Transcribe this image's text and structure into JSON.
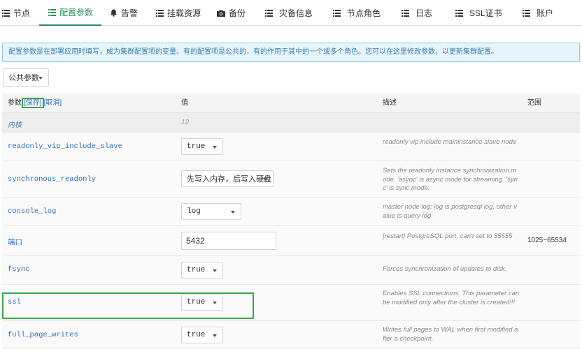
{
  "nav": {
    "items": [
      {
        "label": "节点",
        "icon": "list-icon"
      },
      {
        "label": "配置参数",
        "icon": "list-icon"
      },
      {
        "label": "告警",
        "icon": "bell-icon"
      },
      {
        "label": "挂载资源",
        "icon": "list-icon"
      },
      {
        "label": "备份",
        "icon": "camera-icon"
      },
      {
        "label": "灾备信息",
        "icon": "list-icon"
      },
      {
        "label": "节点角色",
        "icon": "list-icon"
      },
      {
        "label": "日志",
        "icon": "list-icon"
      },
      {
        "label": "SSL证书",
        "icon": "list-icon"
      },
      {
        "label": "账户",
        "icon": "list-icon"
      }
    ],
    "active_index": 1
  },
  "banner": {
    "text": "配置参数是在部署应用时填写，成为集群配置项的变量。有的配置项是公共的，有的作用于其中的一个或多个角色。您可以在这里修改参数，以更新集群配置。"
  },
  "scope_select": {
    "value": "公共参数"
  },
  "table": {
    "headers": {
      "param": "参数",
      "save": "[保存]",
      "cancel": "[取消]",
      "value": "值",
      "desc": "描述",
      "range": "范围"
    },
    "group": {
      "label": "内核",
      "value": "12"
    },
    "rows": [
      {
        "name": "readonly_vip_include_slave",
        "value": "true",
        "desc": "readonly vip include maininstance slave node",
        "range": ""
      },
      {
        "name": "synchronous_readonly",
        "value": "先写入内存，后写入硬盘",
        "desc": "Sets the readonly instance synchronization mode. 'async' is async mode for streaming. 'sync' is sync mode.",
        "range": ""
      },
      {
        "name": "console_log",
        "value": "log",
        "desc": "master node log: log is postgresql log, other value is query log",
        "range": ""
      },
      {
        "name": "端口",
        "value": "5432",
        "desc": "[restart] PostgreSQL port, can't set to 55555",
        "range": "1025~65534"
      },
      {
        "name": "fsync",
        "value": "true",
        "desc": "Forces synchronization of updates to disk.",
        "range": ""
      },
      {
        "name": "ssl",
        "value": "true",
        "desc": "Enables SSL connections. This parameter can be modified only after the cluster is created!!!",
        "range": ""
      },
      {
        "name": "full_page_writes",
        "value": "true",
        "desc": "Writes full pages to WAL when first modified after a checkpoint.",
        "range": ""
      }
    ]
  },
  "colors": {
    "accent": "#2a8f5a",
    "link": "#2d6fbd",
    "highlight": "#3aa84f",
    "banner_border": "#8fc8e8",
    "banner_bg": "#e8f4fb"
  }
}
